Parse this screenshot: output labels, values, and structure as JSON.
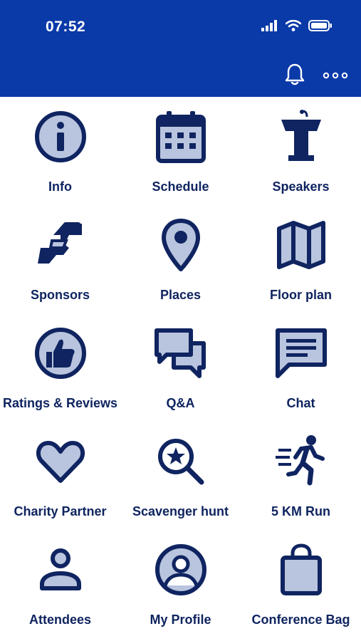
{
  "status": {
    "time": "07:52"
  },
  "header": {
    "actions": [
      "bell-icon",
      "more-icon"
    ]
  },
  "colors": {
    "header_bg": "#0a3aa8",
    "icon_dark": "#0f2460",
    "icon_fill": "#b9c4de"
  },
  "tiles": [
    {
      "label": "Info",
      "icon": "info-icon"
    },
    {
      "label": "Schedule",
      "icon": "calendar-icon"
    },
    {
      "label": "Speakers",
      "icon": "podium-icon"
    },
    {
      "label": "Sponsors",
      "icon": "handshake-icon"
    },
    {
      "label": "Places",
      "icon": "map-pin-icon"
    },
    {
      "label": "Floor plan",
      "icon": "map-icon"
    },
    {
      "label": "Ratings & Reviews",
      "icon": "thumbs-up-icon"
    },
    {
      "label": "Q&A",
      "icon": "chat-bubbles-icon"
    },
    {
      "label": "Chat",
      "icon": "chat-icon"
    },
    {
      "label": "Charity Partner",
      "icon": "heart-icon"
    },
    {
      "label": "Scavenger hunt",
      "icon": "magnifier-star-icon"
    },
    {
      "label": "5 KM Run",
      "icon": "runner-icon"
    },
    {
      "label": "Attendees",
      "icon": "person-icon"
    },
    {
      "label": "My Profile",
      "icon": "profile-icon"
    },
    {
      "label": "Conference Bag",
      "icon": "bag-icon"
    }
  ]
}
